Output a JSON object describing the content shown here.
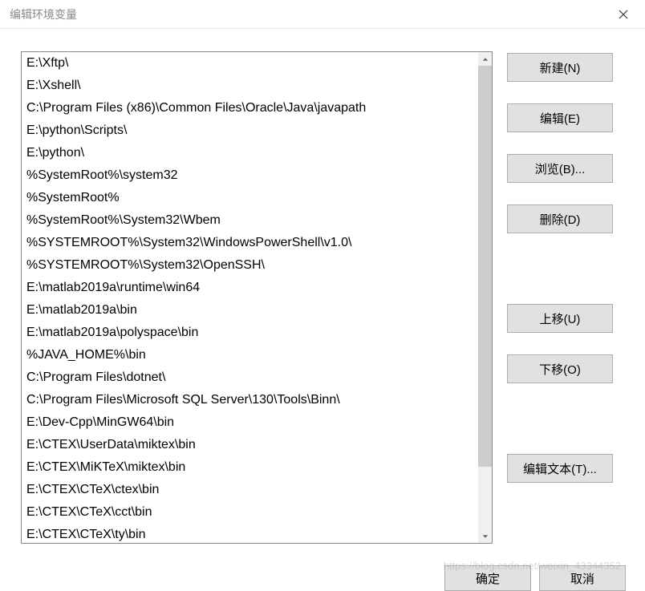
{
  "title": "编辑环境变量",
  "list": {
    "items": [
      "E:\\Xftp\\",
      "E:\\Xshell\\",
      "C:\\Program Files (x86)\\Common Files\\Oracle\\Java\\javapath",
      "E:\\python\\Scripts\\",
      "E:\\python\\",
      "%SystemRoot%\\system32",
      "%SystemRoot%",
      "%SystemRoot%\\System32\\Wbem",
      "%SYSTEMROOT%\\System32\\WindowsPowerShell\\v1.0\\",
      "%SYSTEMROOT%\\System32\\OpenSSH\\",
      "E:\\matlab2019a\\runtime\\win64",
      "E:\\matlab2019a\\bin",
      "E:\\matlab2019a\\polyspace\\bin",
      "%JAVA_HOME%\\bin",
      "C:\\Program Files\\dotnet\\",
      "C:\\Program Files\\Microsoft SQL Server\\130\\Tools\\Binn\\",
      "E:\\Dev-Cpp\\MinGW64\\bin",
      "E:\\CTEX\\UserData\\miktex\\bin",
      "E:\\CTEX\\MiKTeX\\miktex\\bin",
      "E:\\CTEX\\CTeX\\ctex\\bin",
      "E:\\CTEX\\CTeX\\cct\\bin",
      "E:\\CTEX\\CTeX\\ty\\bin"
    ]
  },
  "buttons": {
    "new": "新建(N)",
    "edit": "编辑(E)",
    "browse": "浏览(B)...",
    "delete": "删除(D)",
    "moveUp": "上移(U)",
    "moveDown": "下移(O)",
    "editText": "编辑文本(T)...",
    "ok": "确定",
    "cancel": "取消"
  },
  "watermark": "https://blog.csdn.net/weixin_43344352"
}
